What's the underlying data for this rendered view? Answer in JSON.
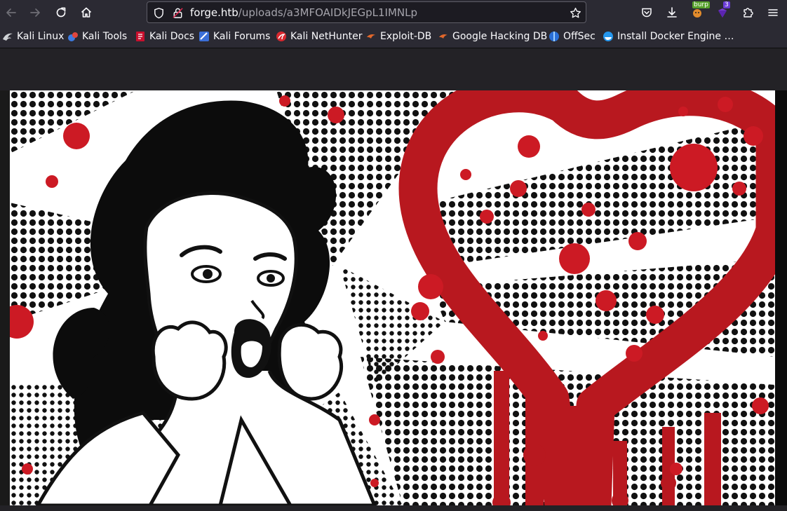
{
  "browser": {
    "url": {
      "host": "forge.htb",
      "path": "/uploads/a3MFOAIDkJEGpL1IMNLp"
    },
    "extensions": {
      "burp_label": "burp",
      "badge_count": "3"
    },
    "bookmarks": [
      {
        "label": "Kali Linux",
        "icon": "kali-dragon-icon"
      },
      {
        "label": "Kali Tools",
        "icon": "kali-tools-icon"
      },
      {
        "label": "Kali Docs",
        "icon": "kali-docs-icon"
      },
      {
        "label": "Kali Forums",
        "icon": "kali-forums-icon"
      },
      {
        "label": "Kali NetHunter",
        "icon": "nethunter-icon"
      },
      {
        "label": "Exploit-DB",
        "icon": "exploit-db-icon"
      },
      {
        "label": "Google Hacking DB",
        "icon": "ghdb-icon"
      },
      {
        "label": "OffSec",
        "icon": "offsec-icon"
      },
      {
        "label": "Install Docker Engine …",
        "icon": "docker-icon"
      }
    ]
  },
  "colors": {
    "toolbar_bg": "#2b2a33",
    "urlbar_bg": "#1c1b22",
    "content_bg": "#232226",
    "heart_red": "#b8181f",
    "blood_red": "#cc1a24"
  }
}
